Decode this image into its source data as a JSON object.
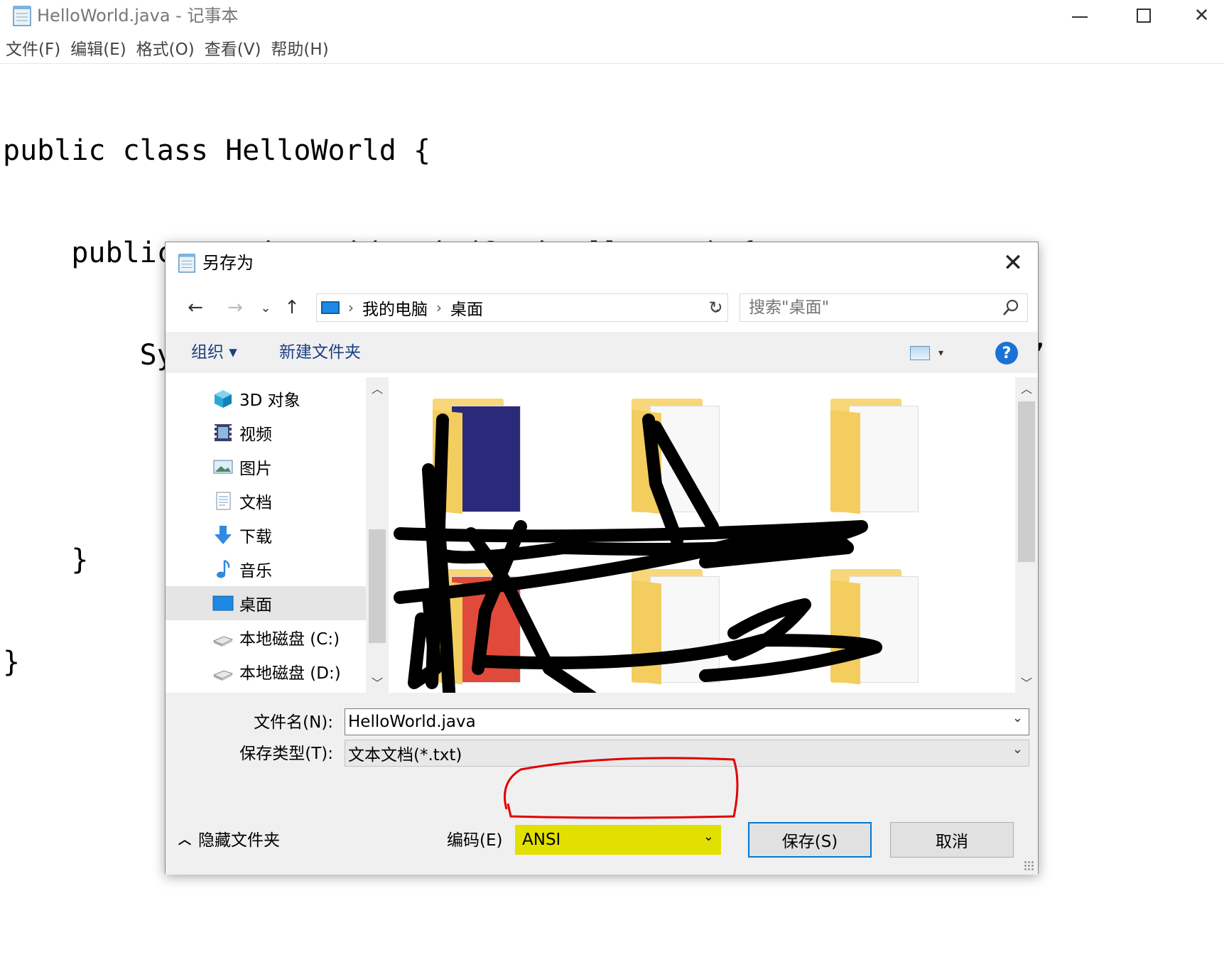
{
  "notepad": {
    "title": "HelloWorld.java - 记事本",
    "menu": [
      "文件(F)",
      "编辑(E)",
      "格式(O)",
      "查看(V)",
      "帮助(H)"
    ],
    "code_lines": [
      "public class HelloWorld {",
      "    public static void main(String[] args) {",
      "        System.out.println(\"你好， 世界\");//打印输出“你好，世界！”",
      "",
      "    }",
      "}"
    ],
    "window_controls": {
      "minimize": "minimize-icon",
      "maximize": "maximize-icon",
      "close": "close-icon"
    }
  },
  "dialog": {
    "title": "另存为",
    "breadcrumb": [
      "我的电脑",
      "桌面"
    ],
    "search_placeholder": "搜索\"桌面\"",
    "toolbar": {
      "organize": "组织 ▾",
      "new_folder": "新建文件夹",
      "help": "?"
    },
    "nav_items": [
      {
        "label": "3D 对象",
        "icon": "3d-objects-icon",
        "selected": false
      },
      {
        "label": "视频",
        "icon": "video-icon",
        "selected": false
      },
      {
        "label": "图片",
        "icon": "pictures-icon",
        "selected": false
      },
      {
        "label": "文档",
        "icon": "documents-icon",
        "selected": false
      },
      {
        "label": "下载",
        "icon": "download-icon",
        "selected": false
      },
      {
        "label": "音乐",
        "icon": "music-icon",
        "selected": false
      },
      {
        "label": "桌面",
        "icon": "desktop-icon",
        "selected": true
      },
      {
        "label": "本地磁盘 (C:)",
        "icon": "drive-icon",
        "selected": false
      },
      {
        "label": "本地磁盘 (D:)",
        "icon": "drive-icon",
        "selected": false
      }
    ],
    "filename_label": "文件名(N):",
    "filename_value": "HelloWorld.java",
    "filetype_label": "保存类型(T):",
    "filetype_value": "文本文档(*.txt)",
    "hide_folders": "隐藏文件夹",
    "encoding_label": "编码(E)",
    "encoding_value": "ANSI",
    "save_button": "保存(S)",
    "cancel_button": "取消",
    "highlight_color": "#e2e000",
    "annotation_color": "#e00000"
  }
}
